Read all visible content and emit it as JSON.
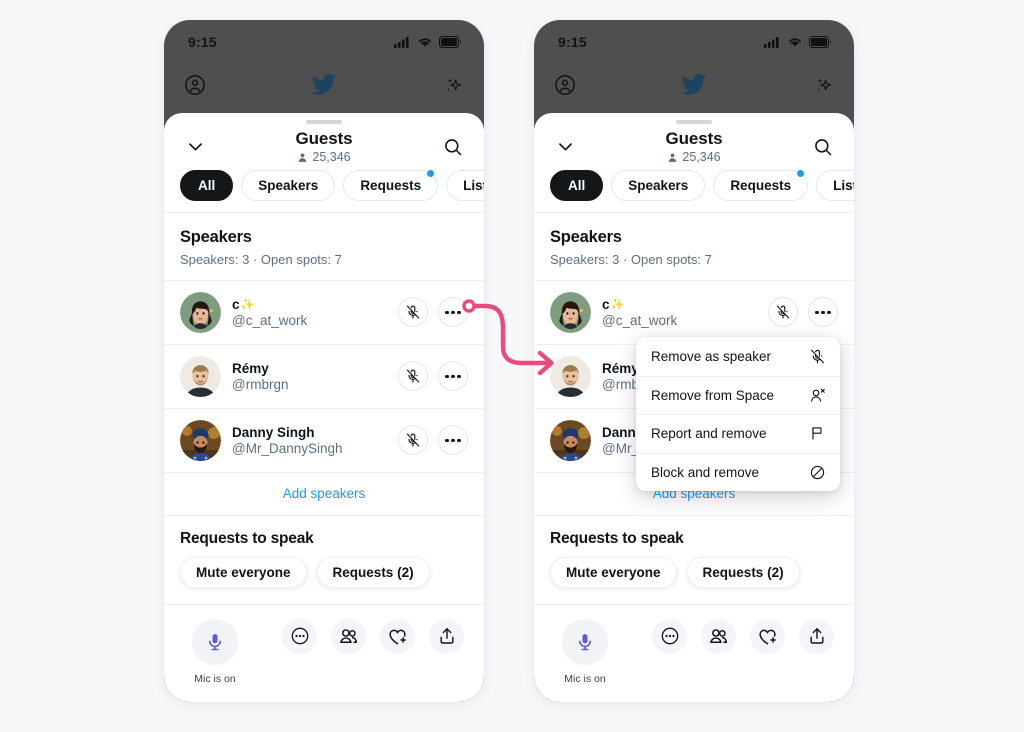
{
  "accent": {
    "pink": "#EC4A7F",
    "twitter_blue": "#1D9BF0",
    "bird_blue": "#1B4461",
    "mic_purple": "#5B5BD6",
    "dark": "#14171A"
  },
  "status_bar": {
    "time": "9:15",
    "icons": [
      "signal-icon",
      "wifi-icon",
      "battery-icon"
    ]
  },
  "top_nav": {
    "left_icon": "account-circle-icon",
    "center_icon": "twitter-bird-icon",
    "right_icon": "sparkle-icon"
  },
  "sheet": {
    "collapse_icon": "chevron-down-icon",
    "title": "Guests",
    "member_count": "25,346",
    "member_icon": "person-icon",
    "search_icon": "search-icon",
    "tabs": [
      {
        "label": "All",
        "active": true,
        "badge": false
      },
      {
        "label": "Speakers",
        "active": false,
        "badge": false
      },
      {
        "label": "Requests",
        "active": false,
        "badge": true
      },
      {
        "label": "Listening",
        "active": false,
        "badge": false
      }
    ]
  },
  "speakers_section": {
    "title": "Speakers",
    "subtitle": "Speakers: 3 · Open spots: 7",
    "add_speakers_label": "Add speakers",
    "people": [
      {
        "name": "c",
        "name_suffix": "✨",
        "handle": "@c_at_work",
        "avatar": "avatar-c",
        "mute_icon": "mic-muted-icon",
        "more_icon": "more-dots-icon"
      },
      {
        "name": "Rémy",
        "name_suffix": "",
        "handle": "@rmbrgn",
        "avatar": "avatar-remy",
        "mute_icon": "mic-muted-icon",
        "more_icon": "more-dots-icon"
      },
      {
        "name": "Danny Singh",
        "name_suffix": "",
        "handle": "@Mr_DannySingh",
        "avatar": "avatar-danny",
        "mute_icon": "mic-muted-icon",
        "more_icon": "more-dots-icon"
      }
    ]
  },
  "requests_section": {
    "title": "Requests to speak",
    "buttons": [
      {
        "label": "Mute everyone"
      },
      {
        "label": "Requests (2)"
      }
    ]
  },
  "bottom_bar": {
    "mic_icon": "microphone-icon",
    "mic_label": "Mic is on",
    "actions": [
      {
        "icon": "more-circle-icon"
      },
      {
        "icon": "people-icon"
      },
      {
        "icon": "heart-plus-icon"
      },
      {
        "icon": "share-upload-icon"
      }
    ]
  },
  "context_menu": {
    "items": [
      {
        "label": "Remove as speaker",
        "icon": "mic-muted-icon"
      },
      {
        "label": "Remove from Space",
        "icon": "person-remove-icon"
      },
      {
        "label": "Report and remove",
        "icon": "flag-icon"
      },
      {
        "label": "Block and remove",
        "icon": "block-icon"
      }
    ]
  },
  "connector": {
    "icon": "curved-arrow-icon",
    "color": "#EC4A7F"
  }
}
